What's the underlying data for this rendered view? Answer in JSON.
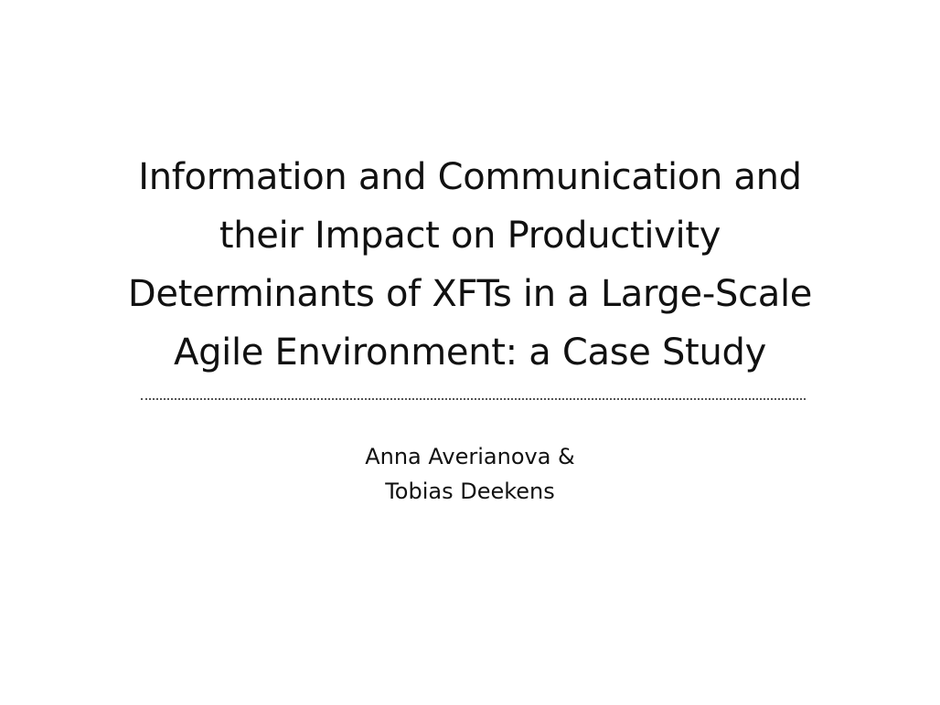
{
  "slide": {
    "title_lines": [
      "Information and Communication and",
      "their Impact on Productivity",
      "Determinants of XFTs in a Large-Scale",
      "Agile Environment: a Case Study"
    ],
    "author_lines": [
      "Anna Averianova &",
      "Tobias Deekens"
    ]
  },
  "colors": {
    "background": "#ffffff",
    "text": "#111111",
    "divider": "#555555"
  }
}
